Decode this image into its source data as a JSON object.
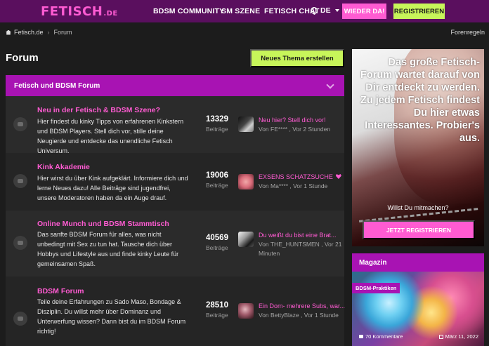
{
  "header": {
    "logo": "FETISCH",
    "logo_tld": ".DE",
    "nav": [
      "BDSM COMMUNITY",
      "SM SZENE",
      "FETISCH CHAT"
    ],
    "lang": "DE",
    "btn_back": "WIEDER DA!",
    "btn_register": "REGISTRIEREN",
    "colors": {
      "bar": "#5a0f5e",
      "pink": "#ff5bd2",
      "green": "#c7f55a"
    }
  },
  "breadcrumb": {
    "home": "Fetisch.de",
    "current": "Forum",
    "rules": "Forenregeln"
  },
  "main": {
    "title": "Forum",
    "new_thread": "Neues Thema erstellen",
    "category": "Fetisch und BDSM Forum",
    "rows": [
      {
        "title": "Neu in der Fetisch & BDSM Szene?",
        "desc": "Hier findest du kinky Tipps von erfahrenen Kinkstern und BDSM Players. Stell dich vor, stille deine Neugierde und entdecke das unendliche Fetisch Universum.",
        "count": "13329",
        "count_label": "Beiträge",
        "last_title": "Neu hier? Stell dich vor!",
        "last_meta": "Von FE**** , Vor 2 Stunden"
      },
      {
        "title": "Kink Akademie",
        "desc": "Hier wirst du über Kink aufgeklärt. Informiere dich und lerne Neues dazu! Alle Beiträge sind jugendfrei, unsere Moderatoren haben da ein Auge drauf.",
        "count": "19006",
        "count_label": "Beiträge",
        "last_title": "EXSENS SCHATZSUCHE",
        "last_meta": "Von Ma**** , Vor 1 Stunde"
      },
      {
        "title": "Online Munch und BDSM Stammtisch",
        "desc": "Das sanfte BDSM Forum für alles, was nicht unbedingt mit Sex zu tun hat. Tausche dich über Hobbys und Lifestyle aus und finde kinky Leute für gemeinsamen Spaß.",
        "count": "40569",
        "count_label": "Beiträge",
        "last_title": "Du weißt du bist eine Brat...",
        "last_meta": "Von THE_HUNTSMEN , Vor 21 Minuten"
      },
      {
        "title": "BDSM Forum",
        "desc": "Teile deine Erfahrungen zu Sado Maso, Bondage & Disziplin. Du willst mehr über Dominanz und Unterwerfung wissen? Dann bist du im BDSM Forum richtig!",
        "count": "28510",
        "count_label": "Beiträge",
        "last_title": "Ein Dom- mehrere Subs, war...",
        "last_meta": "Von BettyBlaze , Vor 1 Stunde"
      }
    ]
  },
  "sidebar": {
    "promo_text": "Das große Fetisch-Forum wartet darauf von Dir entdeckt zu werden. Zu jedem Fetisch findest Du hier etwas Interessantes. Probier's aus.",
    "promo_question": "Willst Du mitmachen?",
    "promo_button": "JETZT REGISTRIEREN",
    "magazine_title": "Magazin",
    "magazine_tag": "BDSM-Praktiken",
    "magazine_comments": "70 Kommentare",
    "magazine_date": "März 11, 2022"
  }
}
